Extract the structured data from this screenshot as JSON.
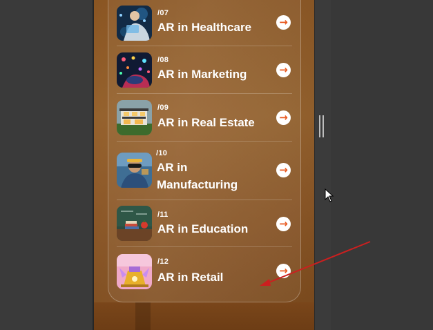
{
  "list": {
    "items": [
      {
        "number": "/07",
        "title": "AR in Healthcare",
        "thumb": "healthcare-photo"
      },
      {
        "number": "/08",
        "title": "AR in Marketing",
        "thumb": "marketing-photo"
      },
      {
        "number": "/09",
        "title": "AR in Real Estate",
        "thumb": "real-estate-photo"
      },
      {
        "number": "/10",
        "title_line1": "AR in",
        "title_line2": "Manufacturing",
        "thumb": "manufacturing-photo"
      },
      {
        "number": "/11",
        "title": "AR in Education",
        "thumb": "education-photo"
      },
      {
        "number": "/12",
        "title": "AR in Retail",
        "thumb": "retail-photo"
      }
    ],
    "action_icon": "arrow-right-circle-icon"
  },
  "annotation": {
    "arrow_color": "#cc1f1f"
  },
  "colors": {
    "panel": "#8c5726",
    "accent": "#e8581f",
    "background": "#3c3c3c"
  }
}
